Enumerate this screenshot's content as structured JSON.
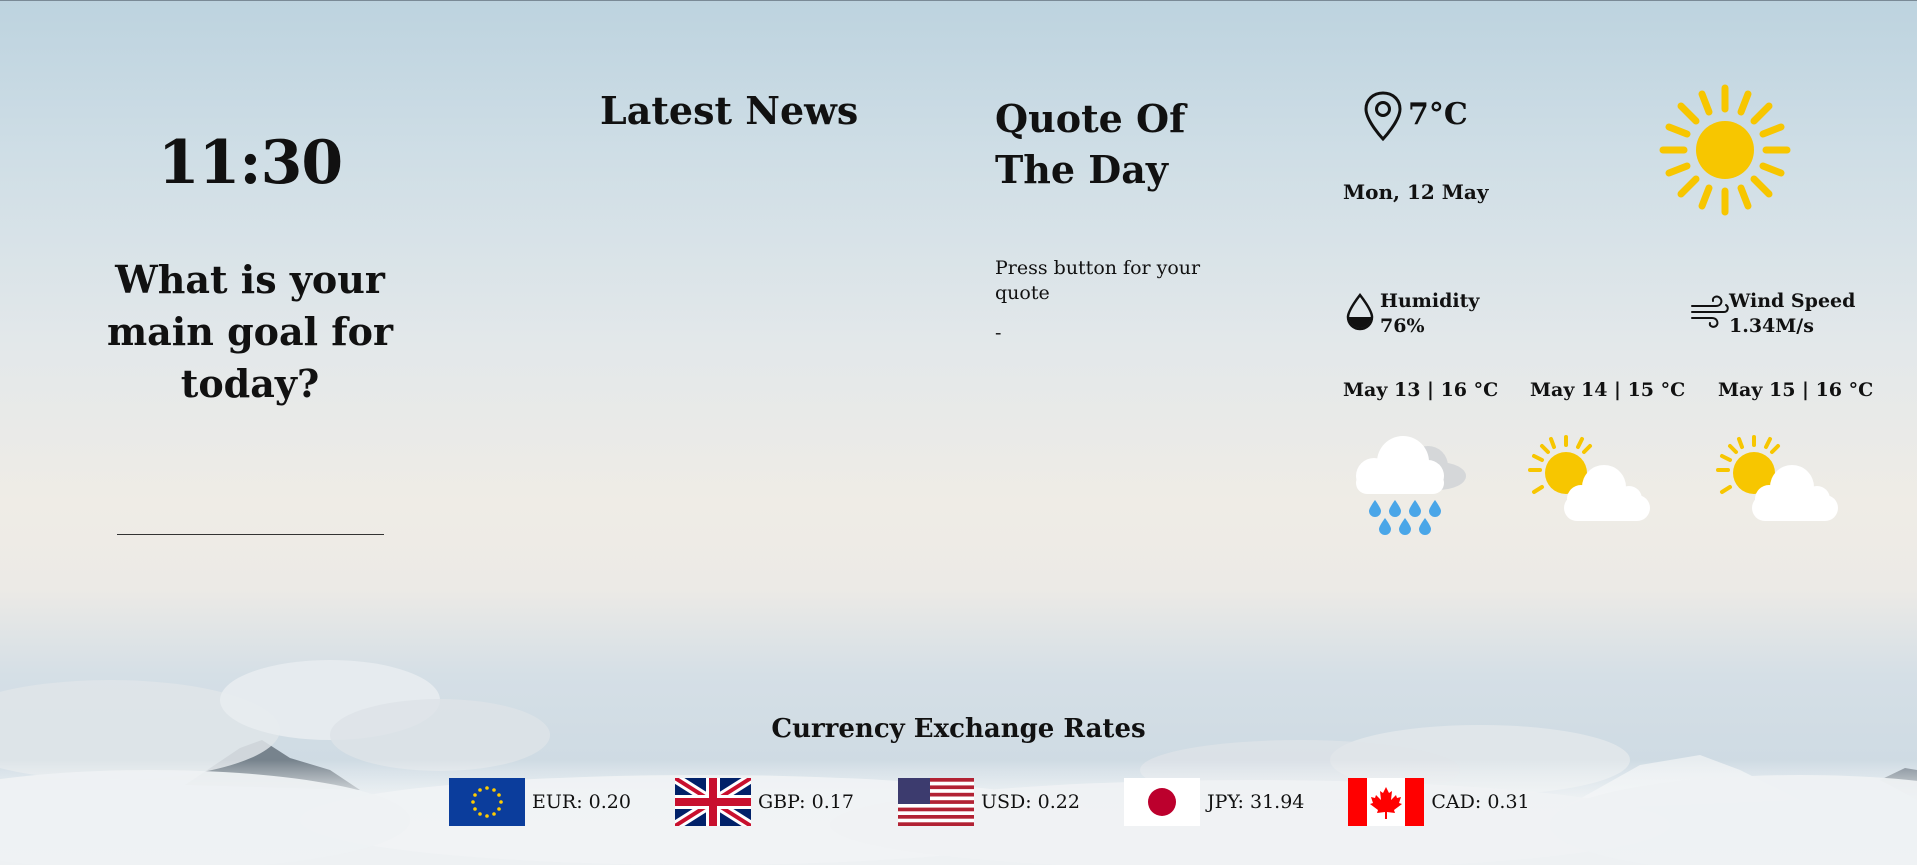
{
  "clock": {
    "time": "11:30"
  },
  "focus": {
    "prompt": "What is your main goal for today?",
    "input_value": ""
  },
  "news": {
    "title": "Latest News"
  },
  "quote": {
    "title": "Quote Of The Day",
    "text": "Press button for your quote",
    "author": "-"
  },
  "weather": {
    "temperature": "7°C",
    "date": "Mon, 12 May",
    "current_icon": "sun-icon",
    "humidity_label": "Humidity",
    "humidity_value": "76%",
    "wind_label": "Wind Speed",
    "wind_value": "1.34M/s",
    "forecast": [
      {
        "label": "May 13 | 16 °C",
        "icon": "rain-cloud-icon"
      },
      {
        "label": "May 14 | 15 °C",
        "icon": "partly-cloudy-icon"
      },
      {
        "label": "May 15 | 16 °C",
        "icon": "partly-cloudy-icon"
      }
    ]
  },
  "currency": {
    "title": "Currency Exchange Rates",
    "rates": [
      {
        "flag": "eu-flag-icon",
        "text": "EUR: 0.20"
      },
      {
        "flag": "uk-flag-icon",
        "text": "GBP: 0.17"
      },
      {
        "flag": "us-flag-icon",
        "text": "USD: 0.22"
      },
      {
        "flag": "japan-flag-icon",
        "text": "JPY: 31.94"
      },
      {
        "flag": "canada-flag-icon",
        "text": "CAD: 0.31"
      }
    ]
  },
  "colors": {
    "sun": "#f7c600",
    "rain": "#4aa6e8",
    "cloud": "#ffffff",
    "text": "#111111"
  }
}
